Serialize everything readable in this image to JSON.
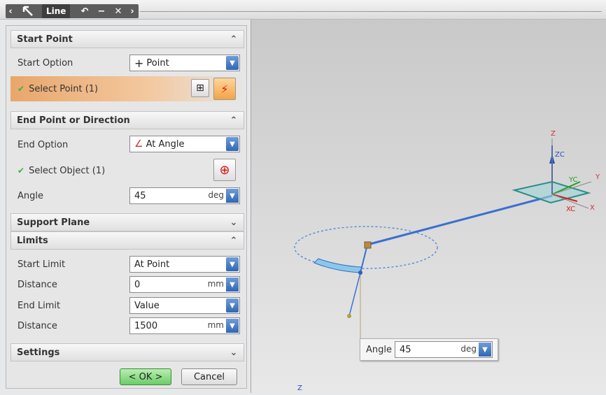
{
  "toolbar": {
    "title": "Line",
    "back_icon": "chevron-left-icon",
    "forward_icon": "chevron-right-icon",
    "undo_icon": "undo-icon",
    "minimize_icon": "minimize-icon",
    "close_icon": "close-icon",
    "arrow_icon": "arrow-cursor-icon"
  },
  "start_point": {
    "header": "Start Point",
    "option_label": "Start Option",
    "option_value": "Point",
    "select_label": "Select Point (1)"
  },
  "end_point": {
    "header": "End Point or Direction",
    "option_label": "End Option",
    "option_value": "At Angle",
    "select_label": "Select Object (1)",
    "angle_label": "Angle",
    "angle_value": "45",
    "angle_unit": "deg"
  },
  "support_plane": {
    "header": "Support Plane"
  },
  "limits": {
    "header": "Limits",
    "start_limit_label": "Start Limit",
    "start_limit_value": "At Point",
    "distance1_label": "Distance",
    "distance1_value": "0",
    "distance1_unit": "mm",
    "end_limit_label": "End Limit",
    "end_limit_value": "Value",
    "distance2_label": "Distance",
    "distance2_value": "1500",
    "distance2_unit": "mm"
  },
  "settings": {
    "header": "Settings"
  },
  "buttons": {
    "ok": "< OK >",
    "cancel": "Cancel"
  },
  "viewport": {
    "axis_labels": {
      "z": "Z",
      "zc": "ZC",
      "y": "Y",
      "yc": "YC",
      "x": "X",
      "xc": "XC",
      "z_bottom": "Z"
    },
    "popup": {
      "label": "Angle",
      "value": "45",
      "unit": "deg"
    }
  },
  "colors": {
    "selected_row": "#e9a66b",
    "line_blue": "#3a6fd0",
    "plane_teal": "#2a8c8c",
    "ok_green": "#6ccc68"
  }
}
